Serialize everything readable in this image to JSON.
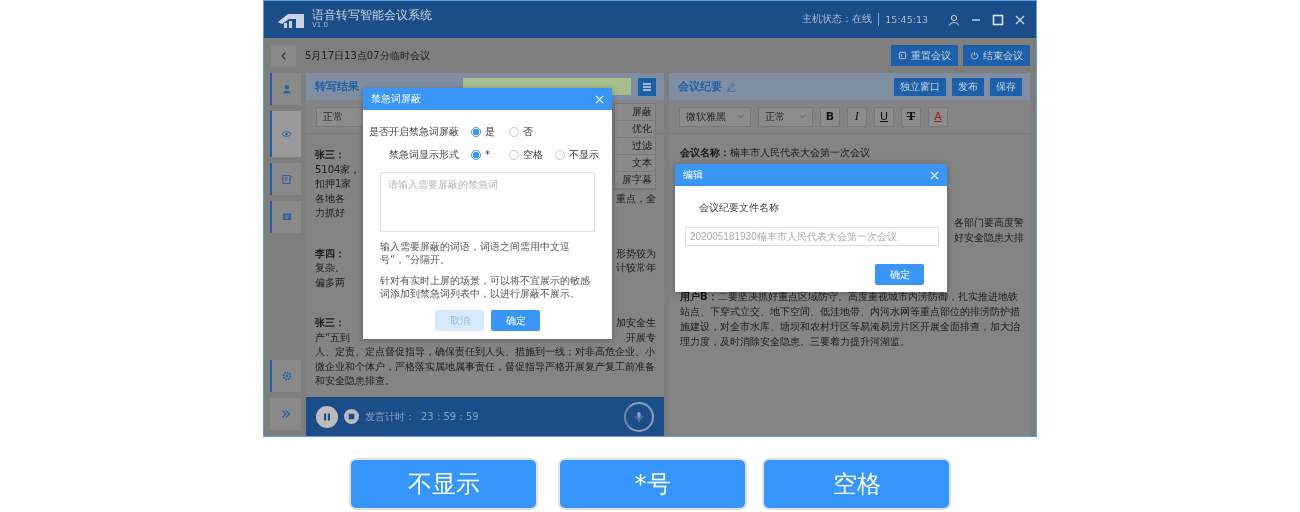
{
  "app": {
    "title": "语音转写智能会议系统",
    "version": "V1.0",
    "host_status": "主机状态：在线",
    "time": "15:45:13"
  },
  "meeting": {
    "title": "5月17日13点07分临时会议",
    "actions": [
      {
        "label": "重置会议",
        "kind": "reset"
      },
      {
        "label": "结束会议",
        "kind": "power"
      }
    ]
  },
  "sidebar": {
    "items": [
      {
        "kind": "user",
        "selected": false
      },
      {
        "kind": "eye",
        "selected": true
      },
      {
        "kind": "note",
        "selected": false
      },
      {
        "kind": "chat",
        "selected": false
      }
    ],
    "bottom": [
      {
        "kind": "settings"
      },
      {
        "kind": "expand"
      }
    ]
  },
  "transcript": {
    "title": "转写结果",
    "style_select": "正常",
    "menu_items": [
      "屏蔽",
      "优化",
      "过滤",
      "文本",
      "屏字幕"
    ],
    "paragraphs": [
      {
        "speaker": "张三：",
        "lines": [
          {
            "left": "5104家，"
          },
          {
            "left": "扣押1家"
          },
          {
            "left": "各地各",
            "right": "重点，全"
          },
          {
            "left": "力抓好"
          }
        ]
      },
      {
        "speaker": "李四：",
        "speaker_right": "形势较为",
        "lines": [
          {
            "left": "复杂。",
            "right": "计较常年"
          },
          {
            "left": "偏多两"
          }
        ]
      },
      {
        "speaker": "张三：",
        "speaker_right": "加安全生",
        "lines": [
          {
            "left": "产“五到",
            "right": "开展专"
          }
        ],
        "tail": "人、定责、定点督促指导，确保责任到人头、措施到一线；对非高危企业、小微企业和个体户，严格落实属地属事责任，督促指导严格开展复产复工前准备和安全隐患排查。"
      }
    ],
    "timer_label": "发言计时：",
    "timer": "23 : 59 : 59"
  },
  "minutes": {
    "title": "会议纪要",
    "actions": [
      "独立窗口",
      "发布",
      "保存"
    ],
    "font_select": "微软雅黑",
    "size_select": "正常",
    "format_buttons": [
      {
        "label": "B",
        "kind": "bold"
      },
      {
        "label": "I",
        "kind": "italic"
      },
      {
        "label": "U",
        "kind": "underline"
      },
      {
        "label": "T",
        "kind": "strike"
      },
      {
        "label": "A",
        "kind": "color"
      }
    ],
    "heading": "**会议名称：**楠丰市人民代表大会第一次会议",
    "fragments": [
      "各部门要高度警",
      "好安全隐患大排"
    ],
    "paragraph": "**用户B：**二要坚决抓好重点区域防守。高度重视城市内涝防御，扎实推进地铁站点、下穿式立交、地下空间、低洼地带、内河水网等重点部位的排涝防护措施建设，对全市水库、塘坝和农村圩区等易淹易涝片区开展全面排查，加大治理力度，及时消除安全隐患。三要着力提升河湖监。"
  },
  "word_filter": {
    "title": "禁急词屏蔽",
    "rows": [
      {
        "label": "是否开启禁急词屏蔽",
        "options": [
          {
            "label": "是",
            "selected": true
          },
          {
            "label": "否",
            "selected": false
          }
        ]
      },
      {
        "label": "禁急词显示形式",
        "options": [
          {
            "label": "*",
            "selected": true
          },
          {
            "label": "空格",
            "selected": false
          },
          {
            "label": "不显示",
            "selected": false
          }
        ]
      }
    ],
    "placeholder": "请输入需要屏蔽的禁急词",
    "notes": [
      "输入需要屏蔽的词语，词语之间需用中文逗号“，”分隔开。",
      "针对有实时上屏的场景，可以将不宜展示的敏感词添加到禁急词列表中，以进行屏蔽不展示。"
    ],
    "buttons": [
      {
        "label": "取消",
        "disabled": true
      },
      {
        "label": "确定",
        "disabled": false
      }
    ]
  },
  "edit_dialog": {
    "title": "编辑",
    "field_label": "会议纪要文件名称",
    "value": "202005181930楠丰市人民代表大会第一次会议",
    "button": "确定"
  },
  "display_options": [
    "不显示",
    "*号",
    "空格"
  ]
}
